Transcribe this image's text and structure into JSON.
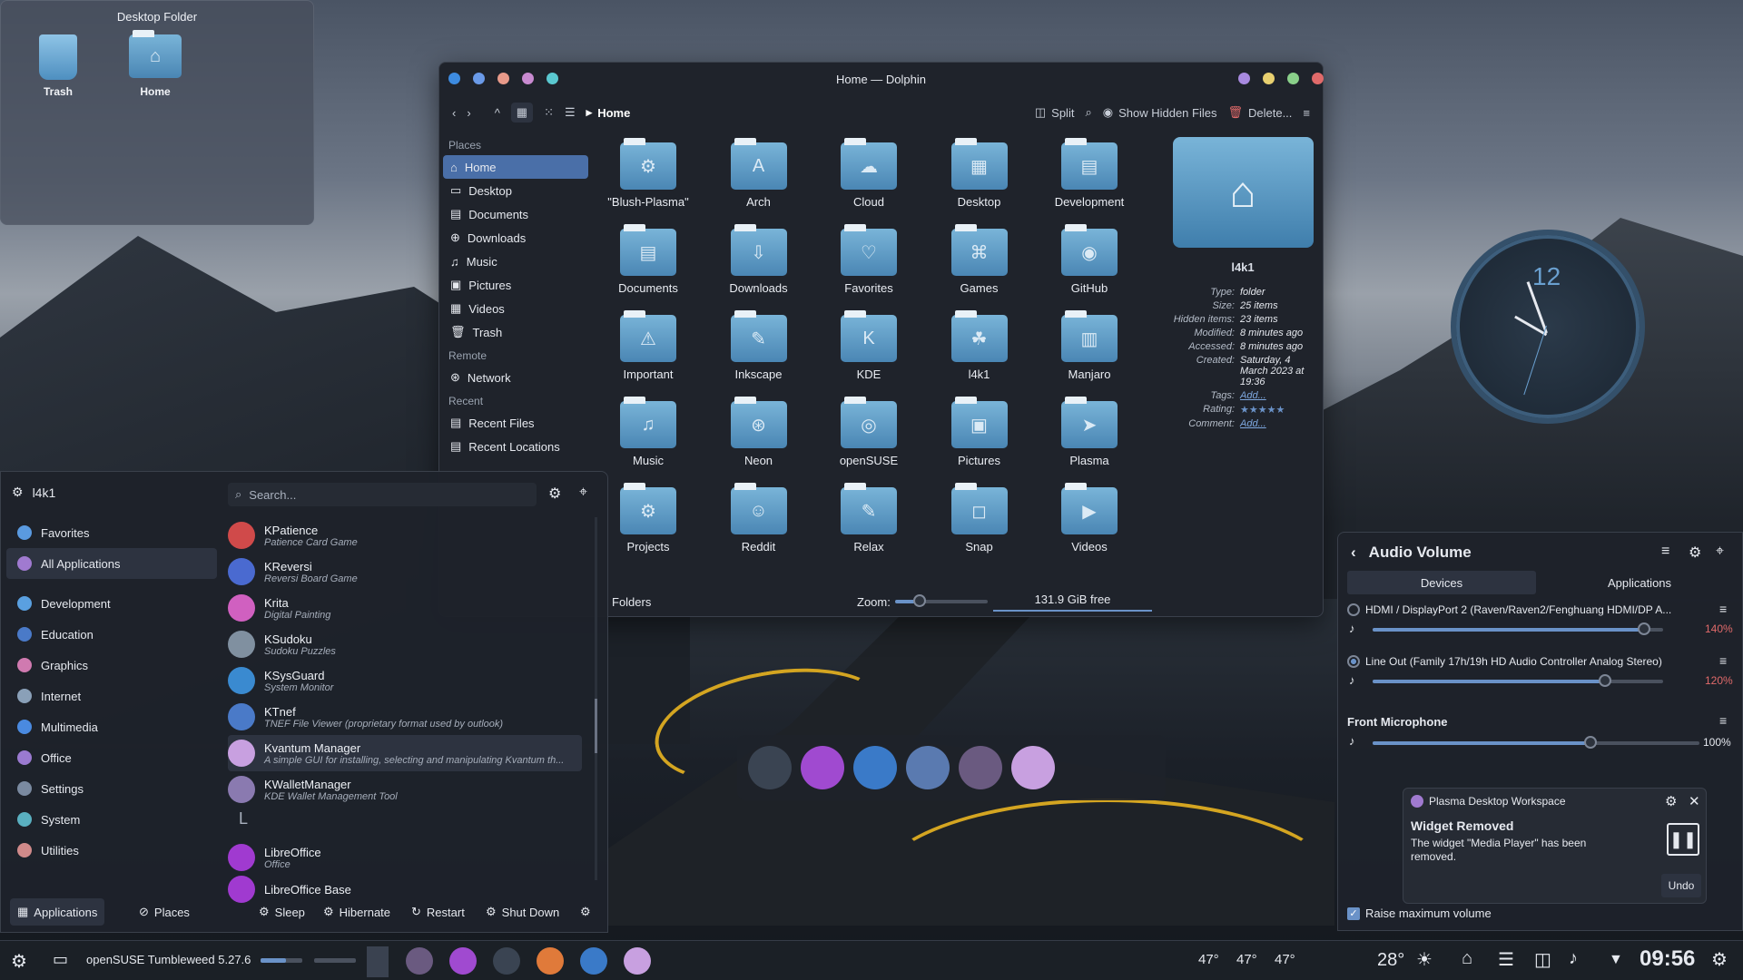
{
  "desktop_folder": {
    "title": "Desktop Folder",
    "items": [
      "Trash",
      "Home"
    ]
  },
  "dolphin": {
    "title": "Home — Dolphin",
    "breadcrumb": "Home",
    "toolbar": {
      "split": "Split",
      "show_hidden": "Show Hidden Files",
      "delete": "Delete..."
    },
    "places_header": "Places",
    "places": [
      "Home",
      "Desktop",
      "Documents",
      "Downloads",
      "Music",
      "Pictures",
      "Videos",
      "Trash"
    ],
    "remote_header": "Remote",
    "remote": [
      "Network"
    ],
    "recent_header": "Recent",
    "recent": [
      "Recent Files",
      "Recent Locations"
    ],
    "folders": [
      "\"Blush-Plasma\"",
      "Arch",
      "Cloud",
      "Desktop",
      "Development",
      "Documents",
      "Downloads",
      "Favorites",
      "Games",
      "GitHub",
      "Important",
      "Inkscape",
      "KDE",
      "l4k1",
      "Manjaro",
      "Music",
      "Neon",
      "openSUSE",
      "Pictures",
      "Plasma",
      "Projects",
      "Reddit",
      "Relax",
      "Snap",
      "Videos"
    ],
    "info": {
      "name": "l4k1",
      "type_label": "Type:",
      "type": "folder",
      "size_label": "Size:",
      "size": "25 items",
      "hidden_label": "Hidden items:",
      "hidden": "23 items",
      "modified_label": "Modified:",
      "modified": "8 minutes ago",
      "accessed_label": "Accessed:",
      "accessed": "8 minutes ago",
      "created_label": "Created:",
      "created": "Saturday, 4 March 2023 at 19:36",
      "tags_label": "Tags:",
      "tags": "Add...",
      "rating_label": "Rating:",
      "rating": "★★★★★",
      "comment_label": "Comment:",
      "comment": "Add..."
    },
    "status": {
      "folders": "Folders",
      "zoom": "Zoom:",
      "free": "131.9 GiB free"
    }
  },
  "launcher": {
    "user": "l4k1",
    "search_placeholder": "Search...",
    "categories": [
      "Favorites",
      "All Applications",
      "Development",
      "Education",
      "Graphics",
      "Internet",
      "Multimedia",
      "Office",
      "Settings",
      "System",
      "Utilities"
    ],
    "apps": [
      {
        "name": "KPatience",
        "desc": "Patience Card Game"
      },
      {
        "name": "KReversi",
        "desc": "Reversi Board Game"
      },
      {
        "name": "Krita",
        "desc": "Digital Painting"
      },
      {
        "name": "KSudoku",
        "desc": "Sudoku Puzzles"
      },
      {
        "name": "KSysGuard",
        "desc": "System Monitor"
      },
      {
        "name": "KTnef",
        "desc": "TNEF File Viewer (proprietary format used by outlook)"
      },
      {
        "name": "Kvantum Manager",
        "desc": "A simple GUI for installing, selecting and manipulating Kvantum th..."
      },
      {
        "name": "KWalletManager",
        "desc": "KDE Wallet Management Tool"
      }
    ],
    "section_letter": "L",
    "apps_l": [
      {
        "name": "LibreOffice",
        "desc": "Office"
      },
      {
        "name": "LibreOffice Base",
        "desc": ""
      }
    ],
    "footer": {
      "applications": "Applications",
      "places": "Places",
      "sleep": "Sleep",
      "hibernate": "Hibernate",
      "restart": "Restart",
      "shutdown": "Shut Down"
    }
  },
  "audio": {
    "title": "Audio Volume",
    "tab_devices": "Devices",
    "tab_apps": "Applications",
    "devices": [
      {
        "name": "HDMI / DisplayPort 2 (Raven/Raven2/Fenghuang HDMI/DP A...",
        "volume": "140%",
        "level": 1.4
      },
      {
        "name": "Line Out (Family 17h/19h HD Audio Controller Analog Stereo)",
        "volume": "120%",
        "level": 1.2
      }
    ],
    "mic": {
      "name": "Front Microphone",
      "volume": "100%",
      "level": 1.0
    },
    "raise_max": "Raise maximum volume"
  },
  "notification": {
    "app": "Plasma Desktop Workspace",
    "title": "Widget Removed",
    "body": "The widget \"Media Player\" has been removed.",
    "undo": "Undo"
  },
  "clock": {
    "number": "12"
  },
  "panel": {
    "os": "openSUSE Tumbleweed 5.27.6",
    "temps": [
      "47°",
      "47°",
      "47°"
    ],
    "weather": "28°",
    "time": "09:56"
  }
}
